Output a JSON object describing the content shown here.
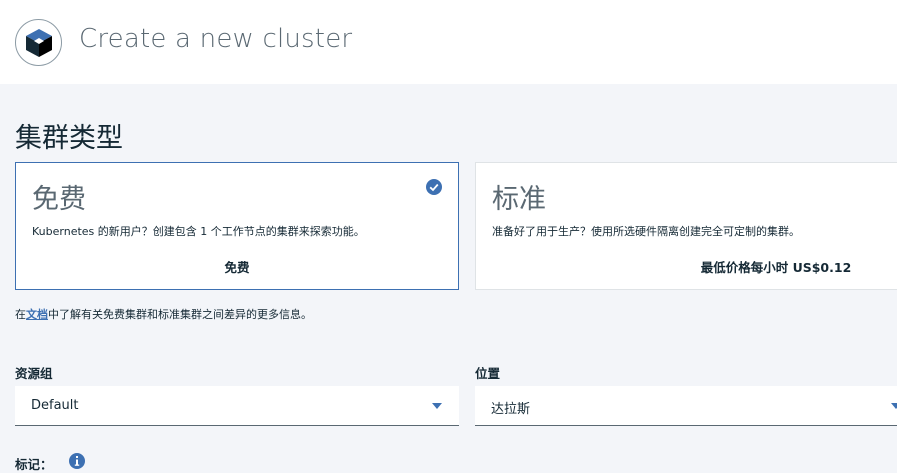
{
  "header": {
    "title": "Create a new cluster",
    "logo_icon": "kubernetes-cube-icon"
  },
  "cluster_type": {
    "title": "集群类型",
    "free": {
      "name": "免费",
      "description": "Kubernetes 的新用户？创建包含 1 个工作节点的集群来探索功能。",
      "price": "免费",
      "selected": true
    },
    "standard": {
      "name": "标准",
      "description": "准备好了用于生产？使用所选硬件隔离创建完全可定制的集群。",
      "price": "最低价格每小时 US$0.12",
      "selected": false
    }
  },
  "doc_note": {
    "prefix": "在",
    "link": "文档",
    "suffix": "中了解有关免费集群和标准集群之间差异的更多信息。"
  },
  "resource_group": {
    "label": "资源组",
    "value": "Default"
  },
  "location": {
    "label": "位置",
    "value": "达拉斯"
  },
  "tags": {
    "label": "标记：",
    "icon": "info-icon"
  },
  "colors": {
    "accent": "#3d70b2",
    "text": "#152935",
    "background": "#f3f5f9"
  }
}
